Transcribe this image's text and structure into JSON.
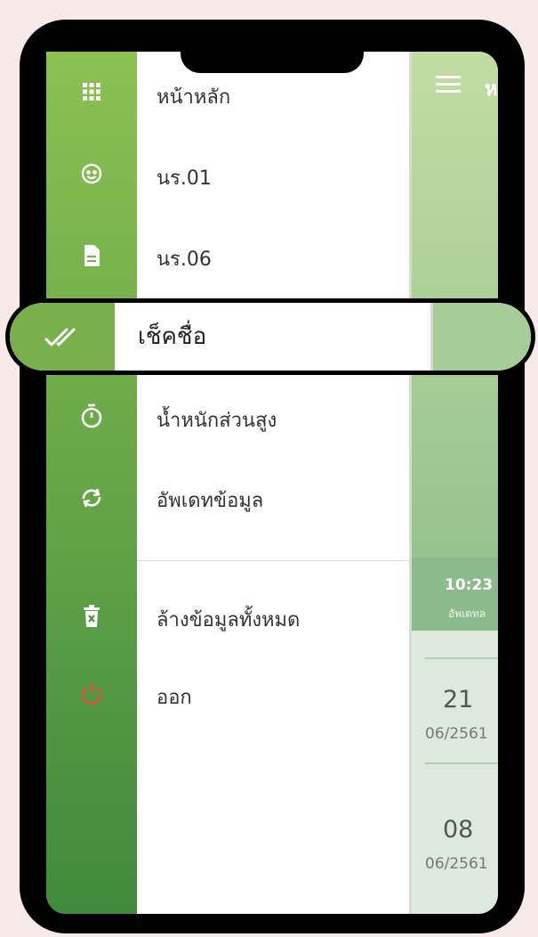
{
  "menu": {
    "items": [
      {
        "label": "หน้าหลัก",
        "icon": "grid-icon"
      },
      {
        "label": "นร.01",
        "icon": "face-icon"
      },
      {
        "label": "นร.06",
        "icon": "document-icon"
      },
      {
        "label": "เช็คชื่อ",
        "icon": "double-check-icon",
        "highlighted": true
      },
      {
        "label": "น้ำหนักส่วนสูง",
        "icon": "stopwatch-icon"
      },
      {
        "label": "อัพเดทข้อมูล",
        "icon": "sync-icon"
      },
      {
        "label": "ล้างข้อมูลทั้งหมด",
        "icon": "trash-icon"
      },
      {
        "label": "ออก",
        "icon": "power-icon"
      }
    ]
  },
  "header": {
    "menu_icon": "hamburger-icon",
    "title_fragment": "ห"
  },
  "status": {
    "time": "10:23",
    "sub_label": "อัพเดทล"
  },
  "records": [
    {
      "day": "21",
      "month_year": "06/2561"
    },
    {
      "day": "08",
      "month_year": "06/2561"
    }
  ],
  "colors": {
    "rail_top": "#8cc152",
    "rail_bottom": "#3f8a3c",
    "power_icon": "#e74c3c",
    "page_bg": "#f9eaea"
  }
}
